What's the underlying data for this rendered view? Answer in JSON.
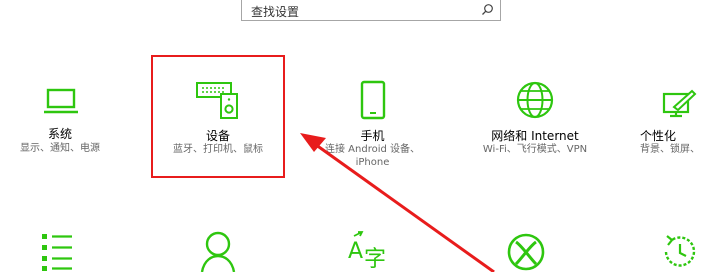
{
  "search": {
    "placeholder": "查找设置"
  },
  "tiles": [
    {
      "title": "系统",
      "subtitle": "显示、通知、电源"
    },
    {
      "title": "设备",
      "subtitle": "蓝牙、打印机、鼠标"
    },
    {
      "title": "手机",
      "subtitle": "连接 Android 设备、",
      "subtitle2": "iPhone"
    },
    {
      "title": "网络和 Internet",
      "subtitle": "Wi-Fi、飞行模式、VPN"
    },
    {
      "title": "个性化",
      "subtitle": "背景、锁屏、"
    }
  ],
  "bottom_row_icons": [
    "apps-icon",
    "accounts-icon",
    "time-language-icon",
    "gaming-icon",
    "update-icon"
  ],
  "colors": {
    "accent": "#2ec60f",
    "annotation": "#e81c1c"
  }
}
